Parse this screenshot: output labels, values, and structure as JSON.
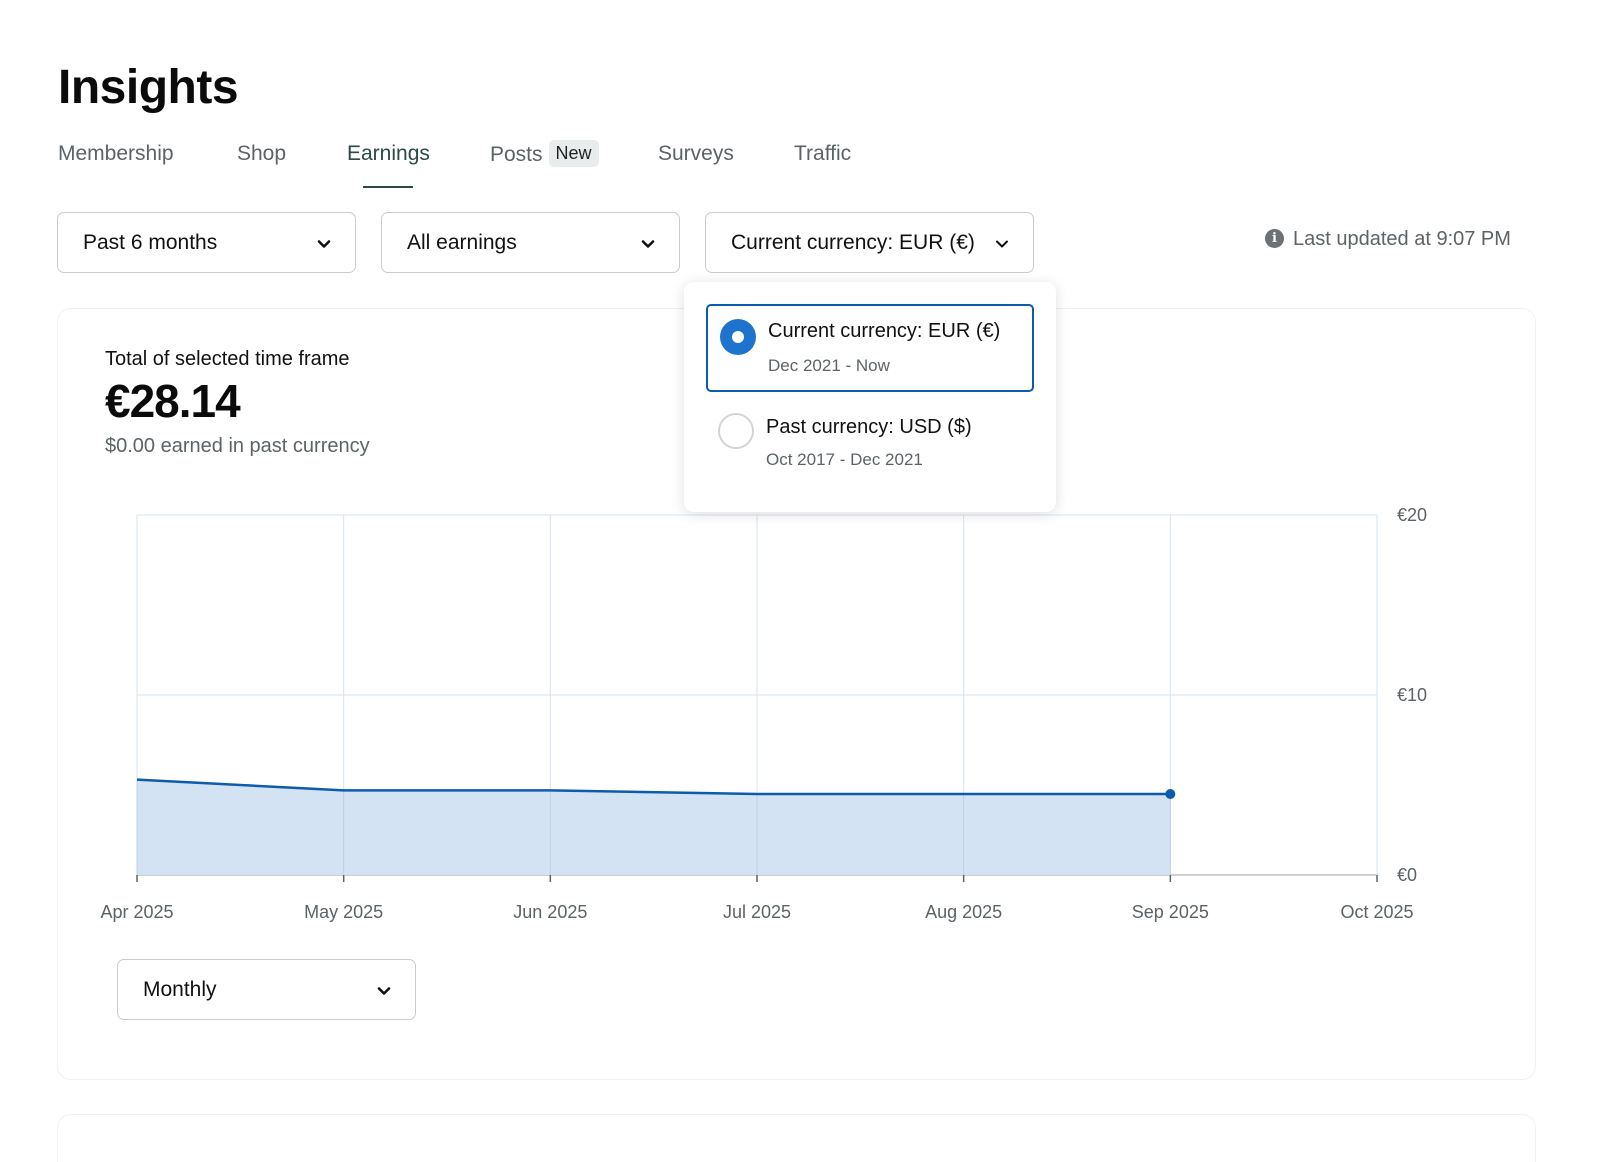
{
  "page": {
    "title": "Insights"
  },
  "tabs": [
    {
      "label": "Membership"
    },
    {
      "label": "Shop"
    },
    {
      "label": "Earnings",
      "active": true
    },
    {
      "label": "Posts",
      "badge": "New"
    },
    {
      "label": "Surveys"
    },
    {
      "label": "Traffic"
    }
  ],
  "filters": {
    "timeframe": "Past 6 months",
    "earnings_type": "All earnings",
    "currency": "Current currency: EUR (€)"
  },
  "last_updated": "Last updated at 9:07 PM",
  "summary": {
    "label": "Total of selected time frame",
    "value": "€28.14",
    "past_currency_note": "$0.00 earned in past currency"
  },
  "currency_menu": {
    "options": [
      {
        "title": "Current currency: EUR (€)",
        "range": "Dec 2021 - Now",
        "selected": true
      },
      {
        "title": "Past currency: USD ($)",
        "range": "Oct 2017 - Dec 2021",
        "selected": false
      }
    ]
  },
  "interval": {
    "selected": "Monthly"
  },
  "colors": {
    "line": "#0b5cad",
    "fill": "#d2e2f2",
    "grid": "#d6e4ef",
    "accent_tab": "#2b4a47"
  },
  "chart_data": {
    "type": "area",
    "x": [
      "Apr 2025",
      "May 2025",
      "Jun 2025",
      "Jul 2025",
      "Aug 2025",
      "Sep 2025",
      "Oct 2025"
    ],
    "series": [
      {
        "values": [
          5.3,
          4.7,
          4.7,
          4.5,
          4.5,
          4.5,
          null
        ]
      }
    ],
    "yticks": [
      "€0",
      "€10",
      "€20"
    ],
    "ylim": [
      0,
      20
    ],
    "grid": true,
    "y_axis_side": "right"
  }
}
